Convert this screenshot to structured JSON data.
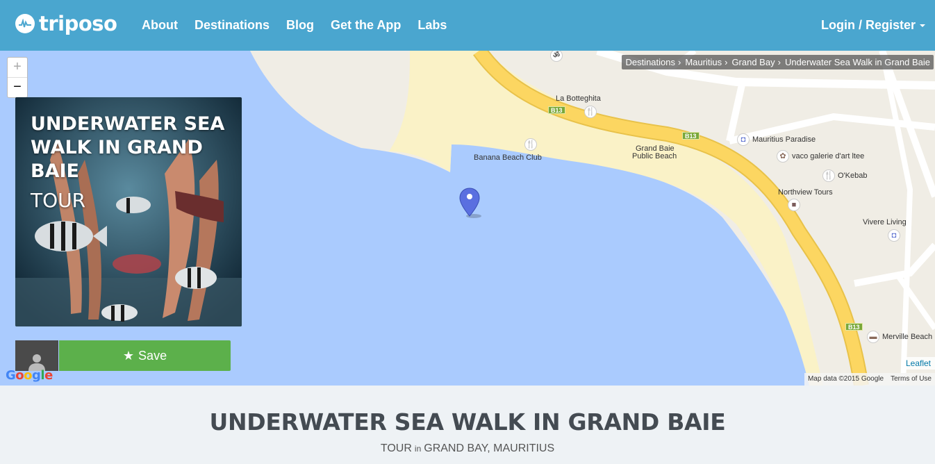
{
  "nav": {
    "logo_text": "triposo",
    "links": [
      "About",
      "Destinations",
      "Blog",
      "Get the App",
      "Labs"
    ],
    "login_label": "Login / Register"
  },
  "map": {
    "zoom_in": "+",
    "zoom_out": "−",
    "breadcrumb": [
      "Destinations",
      "Mauritius",
      "Grand Bay",
      "Underwater Sea Walk in Grand Baie"
    ],
    "poi": {
      "la_botteghita": "La Botteghita",
      "banana_beach_club": "Banana Beach Club",
      "grand_baie_beach_line1": "Grand Baie",
      "grand_baie_beach_line2": "Public Beach",
      "mauritius_paradise": "Mauritius Paradise",
      "vaco": "vaco galerie d'art ltee",
      "okebab": "O'Kebab",
      "northview": "Northview Tours",
      "vivere": "Vivere Living",
      "merville": "Merville Beach"
    },
    "road_shield": "B13",
    "google_logo": "Google",
    "leaflet_link": "Leaflet",
    "map_data": "Map data ©2015 Google",
    "terms": "Terms of Use",
    "colors": {
      "water": "#aacbfe",
      "sand": "#faf2c7",
      "land": "#f0ede5",
      "road": "#fcd661",
      "pin": "#5a6fe0"
    }
  },
  "card": {
    "title": "UNDERWATER SEA WALK IN GRAND BAIE",
    "type": "TOUR",
    "save_label": "Save"
  },
  "page": {
    "title": "UNDERWATER SEA WALK IN GRAND BAIE",
    "subtitle_type": "TOUR",
    "subtitle_in": "in",
    "subtitle_place": "GRAND BAY, MAURITIUS"
  }
}
